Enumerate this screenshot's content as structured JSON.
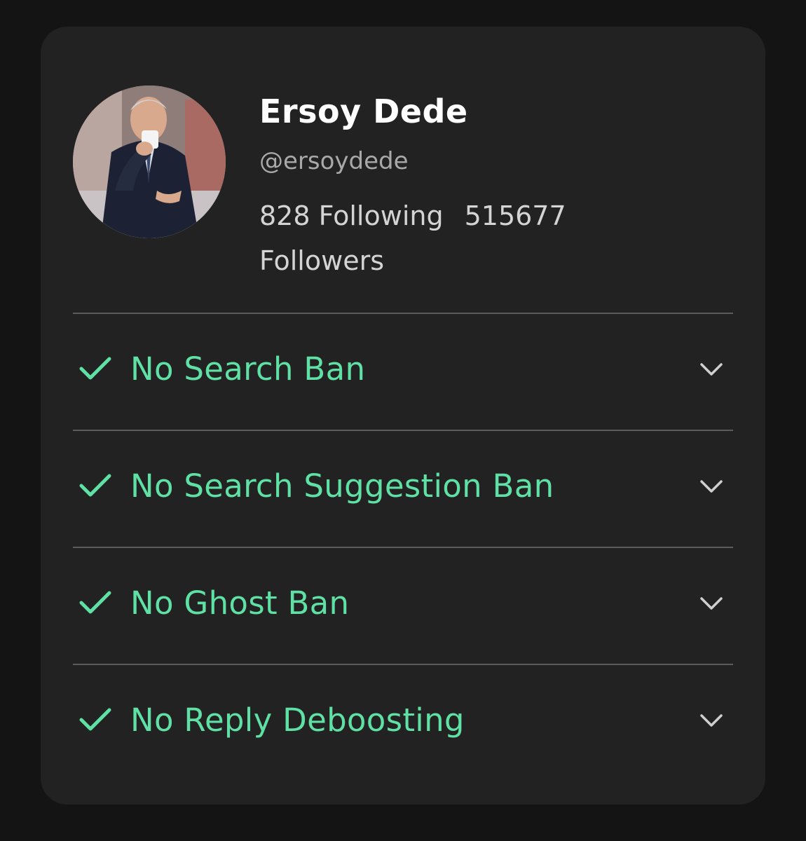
{
  "profile": {
    "name": "Ersoy Dede",
    "handle": "@ersoydede",
    "following_count": "828",
    "following_label": "Following",
    "followers_count": "515677",
    "followers_label": "Followers"
  },
  "checks": [
    {
      "label": "No Search Ban",
      "status": "pass",
      "icon": "check-icon",
      "toggle_icon": "chevron-down-icon"
    },
    {
      "label": "No Search Suggestion Ban",
      "status": "pass",
      "icon": "check-icon",
      "toggle_icon": "chevron-down-icon"
    },
    {
      "label": "No Ghost Ban",
      "status": "pass",
      "icon": "check-icon",
      "toggle_icon": "chevron-down-icon"
    },
    {
      "label": "No Reply Deboosting",
      "status": "pass",
      "icon": "check-icon",
      "toggle_icon": "chevron-down-icon"
    }
  ],
  "colors": {
    "background": "#141414",
    "card": "#222222",
    "pass": "#5fe0a4",
    "name": "#ffffff",
    "handle": "#a9a9a9",
    "stats": "#d4d4d4",
    "divider": "#5c5c5c"
  }
}
